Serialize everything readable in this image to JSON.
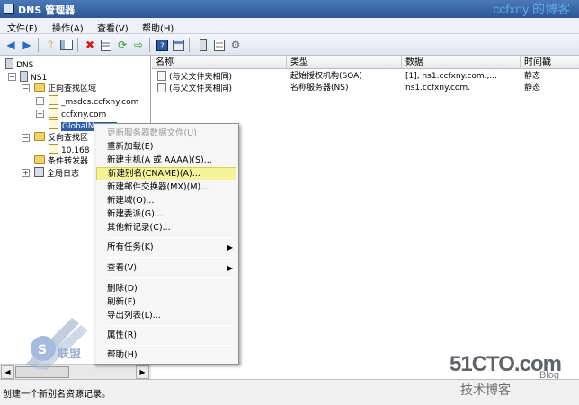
{
  "window": {
    "title": "DNS 管理器",
    "watermark": "ccfxny 的博客"
  },
  "menubar": [
    {
      "label": "文件(F)"
    },
    {
      "label": "操作(A)"
    },
    {
      "label": "查看(V)"
    },
    {
      "label": "帮助(H)"
    }
  ],
  "toolbar": [
    "back-icon",
    "forward-icon",
    "up-icon",
    "show-hide-tree-icon",
    "delete-icon",
    "properties-icon",
    "refresh-icon",
    "export-icon",
    "help-icon",
    "console-icon",
    "dns-record-icon",
    "server-icon",
    "settings-icon"
  ],
  "tree": {
    "root": "DNS",
    "server": "NS1",
    "forward_zones": "正向查找区域",
    "zone_msdcs": "_msdcs.ccfxny.com",
    "zone_main": "ccfxny.com",
    "zone_selected": "GlobalNames",
    "reverse_zones": "反向查找区",
    "reverse_zone_item": "10.168",
    "conditional_forwarders": "条件转发器",
    "global_logs": "全局日志"
  },
  "list": {
    "columns": [
      "名称",
      "类型",
      "数据",
      "时间戳"
    ],
    "rows": [
      {
        "name": "(与父文件夹相同)",
        "type": "起始授权机构(SOA)",
        "data": "[1], ns1.ccfxny.com.,...",
        "timestamp": "静态"
      },
      {
        "name": "(与父文件夹相同)",
        "type": "名称服务器(NS)",
        "data": "ns1.ccfxny.com.",
        "timestamp": "静态"
      }
    ]
  },
  "context_menu": {
    "items": [
      {
        "label": "更新服务器数据文件(U)",
        "disabled": true
      },
      {
        "label": "重新加载(E)"
      },
      {
        "label": "新建主机(A 或 AAAA)(S)..."
      },
      {
        "label": "新建别名(CNAME)(A)...",
        "highlighted": true
      },
      {
        "label": "新建邮件交换器(MX)(M)..."
      },
      {
        "label": "新建域(O)..."
      },
      {
        "label": "新建委派(G)..."
      },
      {
        "label": "其他新记录(C)..."
      },
      {
        "label": "所有任务(K)",
        "submenu": true
      },
      {
        "label": "查看(V)",
        "submenu": true
      },
      {
        "label": "删除(D)"
      },
      {
        "label": "刷新(F)"
      },
      {
        "label": "导出列表(L)..."
      },
      {
        "label": "属性(R)"
      },
      {
        "label": "帮助(H)"
      }
    ],
    "submenu_arrow": "▶"
  },
  "status": {
    "text": "创建一个新别名资源记录。"
  },
  "branding": {
    "logo_51cto": "51CTO.com",
    "logo_blog": "Blog",
    "logo_cn": "技术博客"
  },
  "badge": {
    "text": "联盟"
  }
}
